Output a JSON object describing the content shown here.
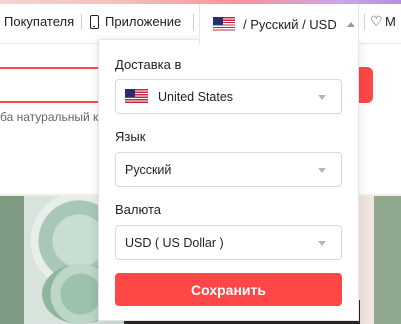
{
  "header": {
    "nav_buyer": "Покупателя",
    "nav_app": "Приложение",
    "nav_wishlist_letter": "М",
    "lang_trigger": "/ Русский /  USD"
  },
  "background": {
    "hint_text": "ба натуральный ко"
  },
  "settings_panel": {
    "ship_to": {
      "label": "Доставка в",
      "value": "United States",
      "flag": "us-flag"
    },
    "language": {
      "label": "Язык",
      "value": "Русский"
    },
    "currency": {
      "label": "Валюта",
      "value": "USD ( US Dollar )"
    },
    "save_label": "Сохранить"
  },
  "colors": {
    "accent": "#ff4747",
    "text": "#222222",
    "border": "#d9d9d9"
  }
}
